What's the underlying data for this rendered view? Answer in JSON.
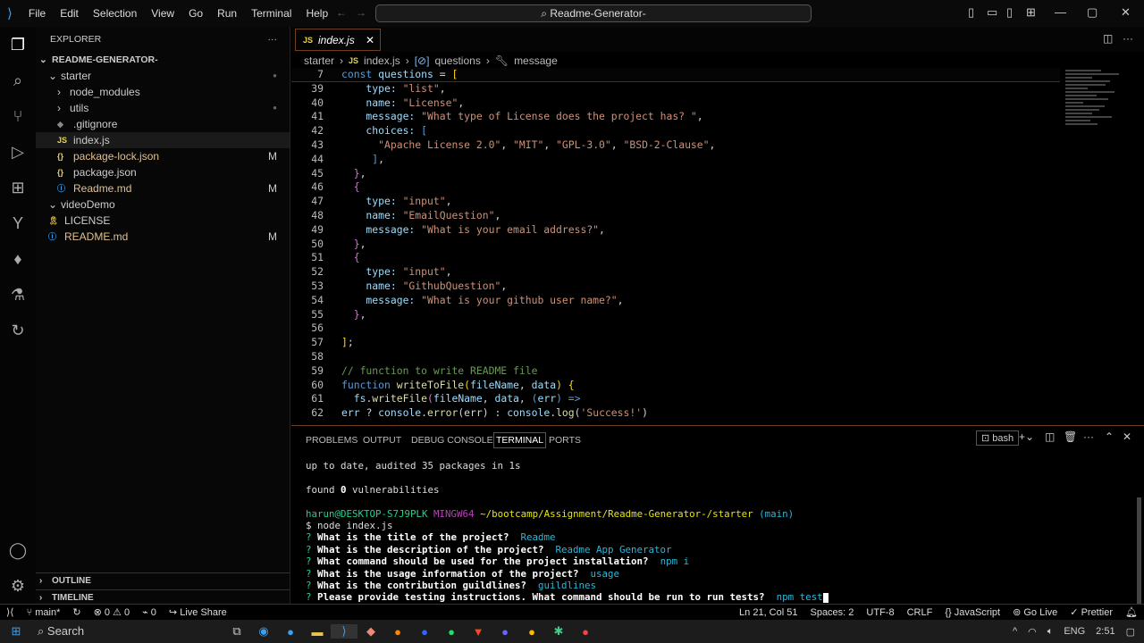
{
  "menu": [
    "File",
    "Edit",
    "Selection",
    "View",
    "Go",
    "Run",
    "Terminal",
    "Help"
  ],
  "search": "Readme-Generator-",
  "explorer": {
    "title": "EXPLORER",
    "root": "README-GENERATOR-",
    "items": [
      {
        "label": "starter",
        "indent": 1,
        "type": "folder-open",
        "mark": ""
      },
      {
        "label": "node_modules",
        "indent": 2,
        "type": "folder",
        "mark": ""
      },
      {
        "label": "utils",
        "indent": 2,
        "type": "folder",
        "mark": ""
      },
      {
        "label": ".gitignore",
        "indent": 2,
        "type": "file",
        "mark": ""
      },
      {
        "label": "index.js",
        "indent": 2,
        "type": "js",
        "mark": ""
      },
      {
        "label": "package-lock.json",
        "indent": 2,
        "type": "json",
        "mark": "M"
      },
      {
        "label": "package.json",
        "indent": 2,
        "type": "json",
        "mark": ""
      },
      {
        "label": "Readme.md",
        "indent": 2,
        "type": "md",
        "mark": "M"
      },
      {
        "label": "videoDemo",
        "indent": 1,
        "type": "folder-open",
        "mark": ""
      },
      {
        "label": "LICENSE",
        "indent": 1,
        "type": "license",
        "mark": ""
      },
      {
        "label": "README.md",
        "indent": 1,
        "type": "md",
        "mark": "M"
      }
    ],
    "outline": "OUTLINE",
    "timeline": "TIMELINE"
  },
  "tab": {
    "label": "index.js",
    "icon": "JS"
  },
  "breadcrumb": [
    "starter",
    "index.js",
    "questions",
    "message"
  ],
  "code": [
    {
      "n": "7",
      "t": [
        [
          "const ",
          "kw"
        ],
        [
          "questions",
          "pr"
        ],
        [
          " = ",
          "pu"
        ],
        [
          "[",
          "yb"
        ]
      ]
    },
    {
      "n": "39",
      "t": [
        [
          "    type: ",
          "pr"
        ],
        [
          "\"list\"",
          "st"
        ],
        [
          ",",
          "pu"
        ]
      ]
    },
    {
      "n": "40",
      "t": [
        [
          "    name: ",
          "pr"
        ],
        [
          "\"License\"",
          "st"
        ],
        [
          ",",
          "pu"
        ]
      ]
    },
    {
      "n": "41",
      "t": [
        [
          "    message: ",
          "pr"
        ],
        [
          "\"What type of License does the project has? \"",
          "st"
        ],
        [
          ",",
          "pu"
        ]
      ]
    },
    {
      "n": "42",
      "t": [
        [
          "    choices: ",
          "pr"
        ],
        [
          "[",
          "kw"
        ]
      ]
    },
    {
      "n": "43",
      "t": [
        [
          "      \"Apache License 2.0\"",
          "st"
        ],
        [
          ", ",
          "pu"
        ],
        [
          "\"MIT\"",
          "st"
        ],
        [
          ", ",
          "pu"
        ],
        [
          "\"GPL-3.0\"",
          "st"
        ],
        [
          ", ",
          "pu"
        ],
        [
          "\"BSD-2-Clause\"",
          "st"
        ],
        [
          ",",
          "pu"
        ]
      ]
    },
    {
      "n": "44",
      "t": [
        [
          "     ]",
          "kw"
        ],
        [
          ",",
          "pu"
        ]
      ]
    },
    {
      "n": "45",
      "t": [
        [
          "  }",
          "br"
        ],
        [
          ",",
          "pu"
        ]
      ]
    },
    {
      "n": "46",
      "t": [
        [
          "  {",
          "br"
        ]
      ]
    },
    {
      "n": "47",
      "t": [
        [
          "    type: ",
          "pr"
        ],
        [
          "\"input\"",
          "st"
        ],
        [
          ",",
          "pu"
        ]
      ]
    },
    {
      "n": "48",
      "t": [
        [
          "    name: ",
          "pr"
        ],
        [
          "\"EmailQuestion\"",
          "st"
        ],
        [
          ",",
          "pu"
        ]
      ]
    },
    {
      "n": "49",
      "t": [
        [
          "    message: ",
          "pr"
        ],
        [
          "\"What is your email address?\"",
          "st"
        ],
        [
          ",",
          "pu"
        ]
      ]
    },
    {
      "n": "50",
      "t": [
        [
          "  }",
          "br"
        ],
        [
          ",",
          "pu"
        ]
      ]
    },
    {
      "n": "51",
      "t": [
        [
          "  {",
          "br"
        ]
      ]
    },
    {
      "n": "52",
      "t": [
        [
          "    type: ",
          "pr"
        ],
        [
          "\"input\"",
          "st"
        ],
        [
          ",",
          "pu"
        ]
      ]
    },
    {
      "n": "53",
      "t": [
        [
          "    name: ",
          "pr"
        ],
        [
          "\"GithubQuestion\"",
          "st"
        ],
        [
          ",",
          "pu"
        ]
      ]
    },
    {
      "n": "54",
      "t": [
        [
          "    message: ",
          "pr"
        ],
        [
          "\"What is your github user name?\"",
          "st"
        ],
        [
          ",",
          "pu"
        ]
      ]
    },
    {
      "n": "55",
      "t": [
        [
          "  }",
          "br"
        ],
        [
          ",",
          "pu"
        ]
      ]
    },
    {
      "n": "56",
      "t": []
    },
    {
      "n": "57",
      "t": [
        [
          "]",
          "yb"
        ],
        [
          ";",
          "pu"
        ]
      ]
    },
    {
      "n": "58",
      "t": []
    },
    {
      "n": "59",
      "t": [
        [
          "// function to write README file",
          "cm"
        ]
      ]
    },
    {
      "n": "60",
      "t": [
        [
          "function ",
          "kw"
        ],
        [
          "writeToFile",
          "fn"
        ],
        [
          "(",
          "yb"
        ],
        [
          "fileName",
          "pr"
        ],
        [
          ", ",
          "pu"
        ],
        [
          "data",
          "pr"
        ],
        [
          ") ",
          "yb"
        ],
        [
          "{",
          "yb"
        ]
      ]
    },
    {
      "n": "61",
      "t": [
        [
          "  fs",
          "pr"
        ],
        [
          ".",
          "pu"
        ],
        [
          "writeFile",
          "fn"
        ],
        [
          "(",
          "br"
        ],
        [
          "fileName",
          "pr"
        ],
        [
          ", ",
          "pu"
        ],
        [
          "data",
          "pr"
        ],
        [
          ", ",
          "pu"
        ],
        [
          "(",
          "kw"
        ],
        [
          "err",
          "pr"
        ],
        [
          ") ",
          "kw"
        ],
        [
          "=>",
          "kw"
        ]
      ]
    },
    {
      "n": "62",
      "t": [
        [
          "err ",
          "pr"
        ],
        [
          "? ",
          "pu"
        ],
        [
          "console",
          "pr"
        ],
        [
          ".",
          "pu"
        ],
        [
          "error",
          "fn"
        ],
        [
          "(err) : ",
          "pu"
        ],
        [
          "console",
          "pr"
        ],
        [
          ".",
          "pu"
        ],
        [
          "log",
          "fn"
        ],
        [
          "(",
          "pu"
        ],
        [
          "'Success!'",
          "st"
        ],
        [
          ")",
          "pu"
        ]
      ]
    }
  ],
  "panel": {
    "tabs": [
      "PROBLEMS",
      "OUTPUT",
      "DEBUG CONSOLE",
      "TERMINAL",
      "PORTS"
    ],
    "active": "TERMINAL",
    "shell": "bash"
  },
  "terminal": {
    "l1": "up to date, audited 35 packages in 1s",
    "found": "found ",
    "zero": "0",
    "vuln": " vulnerabilities",
    "user": "harun@DESKTOP-S7J9PLK",
    "sys": "MINGW64",
    "path": "~/bootcamp/Assignment/Readme-Generator-/starter",
    "branch": "(main)",
    "cmd": "$ node index.js",
    "qa": [
      {
        "q": "What is the title of the project?",
        "a": "Readme"
      },
      {
        "q": "What is the description of the project?",
        "a": "Readme App Generator"
      },
      {
        "q": "What command should be used for the project installation?",
        "a": "npm i"
      },
      {
        "q": "What is the usage information of the project?",
        "a": "usage"
      },
      {
        "q": "What is the contribution guildlines?",
        "a": "guildlines"
      },
      {
        "q": "Please provide testing instructions. What command should be run to run tests?",
        "a": "npm test"
      }
    ]
  },
  "status": {
    "branch": "main*",
    "errors": "0",
    "warnings": "0",
    "ports": "0",
    "liveshare": "Live Share",
    "pos": "Ln 21, Col 51",
    "spaces": "Spaces: 2",
    "enc": "UTF-8",
    "eol": "CRLF",
    "lang": "JavaScript",
    "golive": "Go Live",
    "prettier": "Prettier"
  },
  "taskbar": {
    "search": "Search",
    "lang": "ENG",
    "time": "2:51"
  }
}
